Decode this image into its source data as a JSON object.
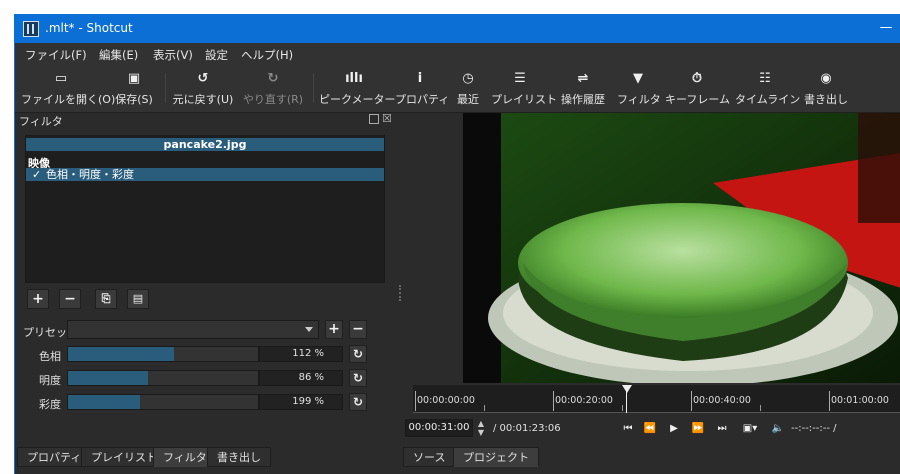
{
  "window": {
    "title": ".mlt* - Shotcut",
    "minimize_glyph": "—"
  },
  "menu": [
    {
      "label": "ファイル(F)"
    },
    {
      "label": "編集(E)"
    },
    {
      "label": "表示(V)"
    },
    {
      "label": "設定"
    },
    {
      "label": "ヘルプ(H)"
    }
  ],
  "toolbar": [
    {
      "label": "ファイルを開く(O)",
      "icon": "folder-open-icon",
      "glyph": "▭"
    },
    {
      "label": "保存(S)",
      "icon": "save-icon",
      "glyph": "▣"
    },
    {
      "label": "元に戻す(U)",
      "icon": "undo-icon",
      "glyph": "↺"
    },
    {
      "label": "やり直す(R)",
      "icon": "redo-icon",
      "glyph": "↻"
    },
    {
      "label": "ピークメーター",
      "icon": "peak-meter-icon",
      "glyph": "ıllı"
    },
    {
      "label": "プロパティ",
      "icon": "info-icon",
      "glyph": "i"
    },
    {
      "label": "最近",
      "icon": "clock-icon",
      "glyph": "◷"
    },
    {
      "label": "プレイリスト",
      "icon": "list-icon",
      "glyph": "☰"
    },
    {
      "label": "操作履歴",
      "icon": "history-icon",
      "glyph": "⇌"
    },
    {
      "label": "フィルタ",
      "icon": "filter-icon",
      "glyph": "▼"
    },
    {
      "label": "キーフレーム",
      "icon": "stopwatch-icon",
      "glyph": "⏱"
    },
    {
      "label": "タイムライン",
      "icon": "timeline-icon",
      "glyph": "☷"
    },
    {
      "label": "書き出し",
      "icon": "export-icon",
      "glyph": "◉"
    }
  ],
  "filter_panel": {
    "title": "フィルタ",
    "clip_name": "pancake2.jpg",
    "group": "映像",
    "check_mark": "✓",
    "filter_item": "色相・明度・彩度",
    "buttons": {
      "add": "+",
      "remove": "−",
      "copy": "⎘",
      "paste": "▤"
    },
    "preset_label": "プリセット",
    "preset_value": "",
    "preset_add": "+",
    "preset_remove": "−",
    "reset_glyph": "↻",
    "params": [
      {
        "label": "色相",
        "display": "112 %",
        "level_pct": 56
      },
      {
        "label": "明度",
        "display": "86 %",
        "level_pct": 42
      },
      {
        "label": "彩度",
        "display": "199 %",
        "level_pct": 38
      }
    ]
  },
  "tabs_left": [
    "プロパティ",
    "プレイリスト",
    "フィルタ",
    "書き出し"
  ],
  "tabs_right": [
    "ソース",
    "プロジェクト"
  ],
  "ruler": {
    "labels": [
      "00:00:00:00",
      "00:00:20:00",
      "00:00:40:00",
      "00:01:00:00"
    ]
  },
  "transport": {
    "position": "00:00:31:00",
    "spin_glyph": "▲\n▼",
    "duration": "/ 00:01:23:06",
    "in_out": "--:--:--:-- /",
    "glyphs": {
      "skip_start": "⏮",
      "rewind": "⏪",
      "play": "▶",
      "forward": "⏩",
      "skip_end": "⏭",
      "zoom": "▣▾",
      "volume": "🔈"
    }
  },
  "colors": {
    "title_bar": "#0b6fd6",
    "selection": "#2a5d7c",
    "background": "#2b2b2b"
  }
}
